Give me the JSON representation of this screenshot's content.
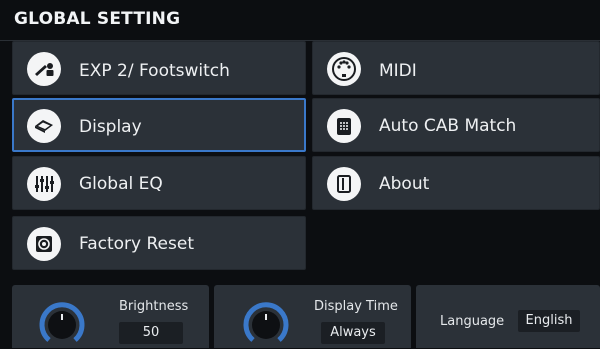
{
  "header": {
    "title": "GLOBAL SETTING"
  },
  "menu": {
    "exp_footswitch": {
      "label": "EXP 2/ Footswitch"
    },
    "midi": {
      "label": "MIDI"
    },
    "display": {
      "label": "Display"
    },
    "auto_cab_match": {
      "label": "Auto CAB Match"
    },
    "global_eq": {
      "label": "Global EQ"
    },
    "about": {
      "label": "About"
    },
    "factory_reset": {
      "label": "Factory Reset"
    }
  },
  "display_settings": {
    "brightness": {
      "label": "Brightness",
      "value": "50",
      "level": 0.5
    },
    "display_time": {
      "label": "Display Time",
      "value": "Always",
      "level": 1.0
    },
    "language": {
      "label": "Language",
      "value": "English"
    }
  },
  "colors": {
    "accent": "#3a78c9",
    "button_bg": "#2b3138",
    "background": "#0c0e11"
  }
}
